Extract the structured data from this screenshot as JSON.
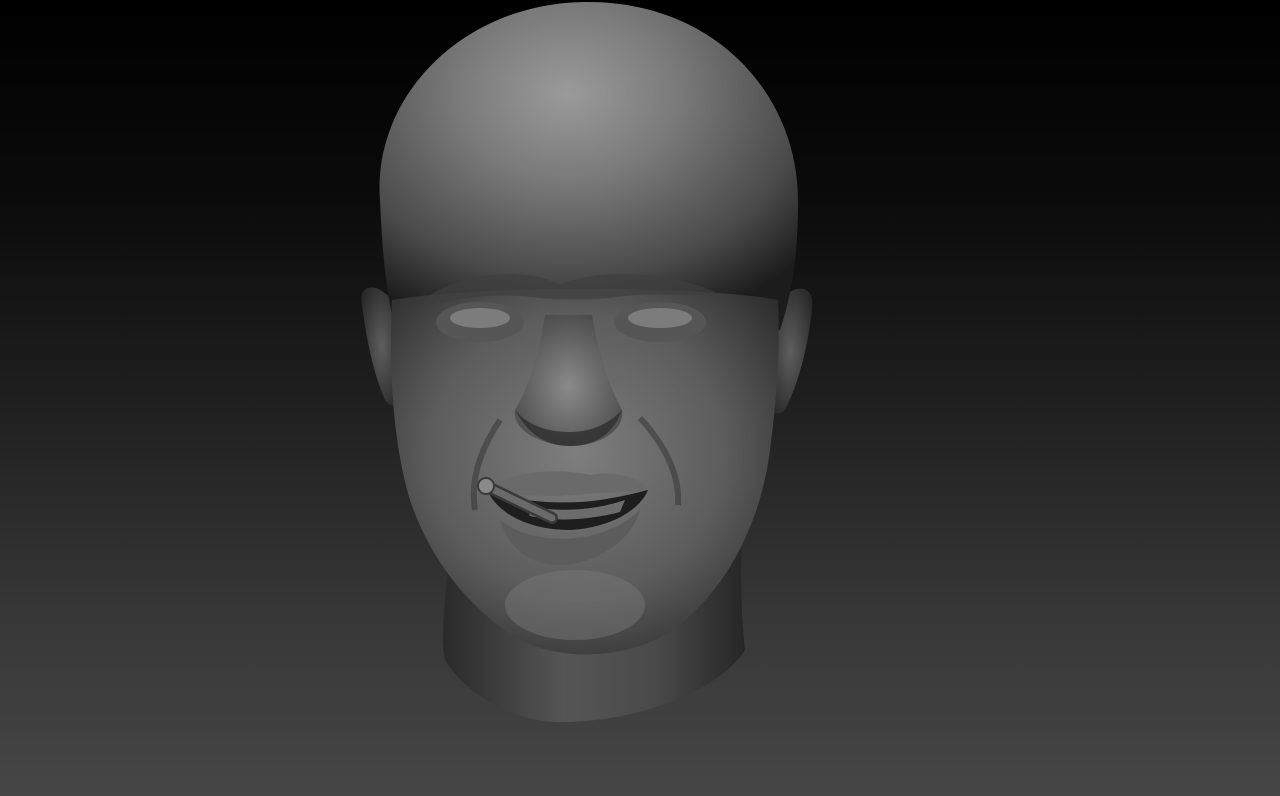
{
  "viewport": {
    "background_top": "#000000",
    "background_bottom": "#464646"
  },
  "model": {
    "material_color": "#6e6e6e",
    "highlight_color": "#9a9a9a",
    "shadow_color": "#1c1c1c"
  }
}
